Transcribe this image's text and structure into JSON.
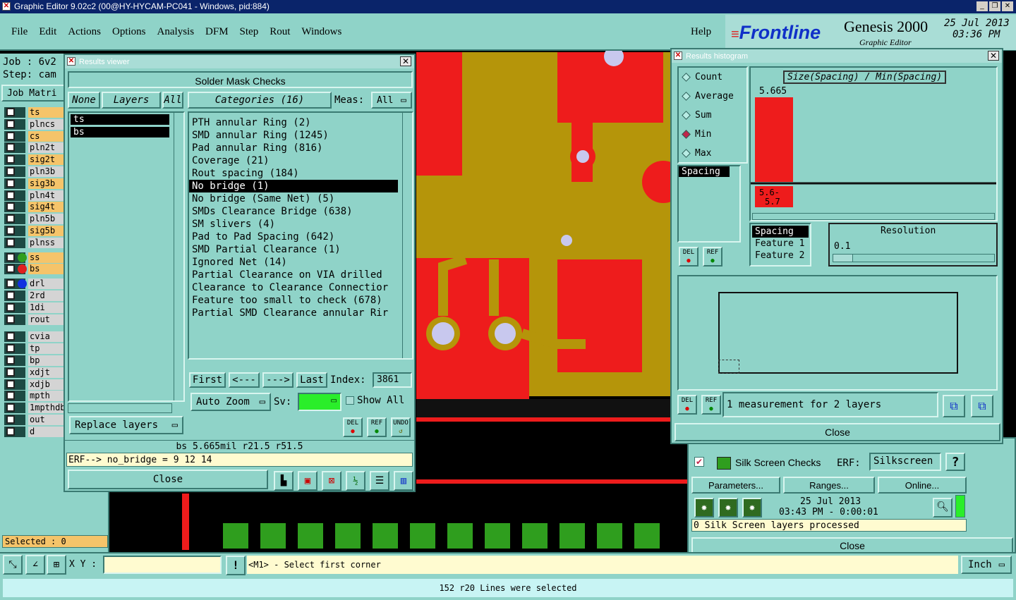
{
  "window_title": "Graphic Editor 9.02c2 (00@HY-HYCAM-PC041 - Windows, pid:884)",
  "menu": [
    "File",
    "Edit",
    "Actions",
    "Options",
    "Analysis",
    "DFM",
    "Step",
    "Rout",
    "Windows"
  ],
  "help": "Help",
  "brand": {
    "logo": "Frontline",
    "product": "Genesis 2000",
    "subtitle": "Graphic Editor",
    "date": "25 Jul 2013",
    "time": "03:36 PM"
  },
  "job_panel": {
    "job": "Job  :  6v2",
    "step": "Step: cam",
    "matrix": "Job Matri",
    "selected": "Selected : 0"
  },
  "layers": [
    {
      "name": "ts",
      "color": "#f5c46a",
      "mark": ""
    },
    {
      "name": "plncs",
      "color": "#d4d4d4",
      "mark": ""
    },
    {
      "name": "cs",
      "color": "#f5c46a",
      "mark": ""
    },
    {
      "name": "pln2t",
      "color": "#d4d4d4",
      "mark": ""
    },
    {
      "name": "sig2t",
      "color": "#f5c46a",
      "mark": ""
    },
    {
      "name": "pln3b",
      "color": "#d4d4d4",
      "mark": ""
    },
    {
      "name": "sig3b",
      "color": "#f5c46a",
      "mark": ""
    },
    {
      "name": "pln4t",
      "color": "#d4d4d4",
      "mark": ""
    },
    {
      "name": "sig4t",
      "color": "#f5c46a",
      "mark": ""
    },
    {
      "name": "pln5b",
      "color": "#d4d4d4",
      "mark": ""
    },
    {
      "name": "sig5b",
      "color": "#f5c46a",
      "mark": ""
    },
    {
      "name": "plnss",
      "color": "#d4d4d4",
      "mark": ""
    },
    {
      "name": "ss",
      "color": "#f5c46a",
      "mark": "#2f9e1e"
    },
    {
      "name": "bs",
      "color": "#f5c46a",
      "mark": "#e02020"
    },
    {
      "name": "drl",
      "color": "#d4d4d4",
      "mark": "#1030e0"
    },
    {
      "name": "2rd",
      "color": "#d4d4d4",
      "mark": ""
    },
    {
      "name": "1di",
      "color": "#d4d4d4",
      "mark": ""
    },
    {
      "name": "rout",
      "color": "#d4d4d4",
      "mark": ""
    },
    {
      "name": "cvia",
      "color": "#d4d4d4",
      "mark": ""
    },
    {
      "name": "tp",
      "color": "#d4d4d4",
      "mark": ""
    },
    {
      "name": "bp",
      "color": "#d4d4d4",
      "mark": ""
    },
    {
      "name": "xdjt",
      "color": "#d4d4d4",
      "mark": ""
    },
    {
      "name": "xdjb",
      "color": "#d4d4d4",
      "mark": ""
    },
    {
      "name": "mpth",
      "color": "#d4d4d4",
      "mark": ""
    },
    {
      "name": "1mpthdb",
      "color": "#d4d4d4",
      "mark": ""
    },
    {
      "name": "out",
      "color": "#d4d4d4",
      "mark": ""
    },
    {
      "name": "d",
      "color": "#d4d4d4",
      "mark": ""
    }
  ],
  "results_viewer": {
    "title": "Results viewer",
    "header": "Solder Mask Checks",
    "btn_none": "None",
    "btn_layers": "Layers",
    "btn_all": "All",
    "categories_label": "Categories (16)",
    "meas_label": "Meas:",
    "meas_value": "All",
    "layer_list": [
      "ts",
      "bs"
    ],
    "categories": [
      "PTH annular Ring (2)",
      "SMD annular Ring (1245)",
      "Pad annular Ring (816)",
      "Coverage (21)",
      "Rout spacing (184)",
      "No bridge (1)",
      "No bridge (Same Net) (5)",
      "SMDs Clearance Bridge (638)",
      "SM slivers (4)",
      "Pad to Pad Spacing (642)",
      "SMD Partial Clearance (1)",
      "Ignored Net (14)",
      "Partial Clearance on VIA drilled",
      "Clearance to Clearance Connectior",
      "Feature too small to check (678)",
      "Partial SMD Clearance annular Rir"
    ],
    "selected_category": 5,
    "nav": {
      "first": "First",
      "prev": "<---",
      "next": "--->",
      "last": "Last",
      "index_label": "Index:",
      "index_value": "3861"
    },
    "auto_zoom": "Auto Zoom",
    "sv_label": "Sv:",
    "show_all": "Show All",
    "replace_layers": "Replace layers",
    "del": "DEL",
    "ref": "REF",
    "undo": "UNDO",
    "measure": "bs 5.665mil   r21.5   r51.5",
    "erf": "ERF--> no_bridge = 9 12 14",
    "close": "Close"
  },
  "histogram": {
    "title": "Results histogram",
    "modes": [
      "Count",
      "Average",
      "Sum",
      "Min",
      "Max"
    ],
    "selected_mode": 3,
    "list": [
      "Spacing"
    ],
    "chart_title": "Size(Spacing) / Min(Spacing)",
    "bar_value": "5.665",
    "bar_bucket": "5.6-\n5.7",
    "fields": [
      "Spacing",
      "Feature 1",
      "Feature 2"
    ],
    "resolution_label": "Resolution",
    "resolution_value": "0.1",
    "status": "1 measurement for 2 layers",
    "del": "DEL",
    "ref": "REF",
    "close": "Close",
    "chart_data": {
      "type": "bar",
      "categories": [
        "5.6-5.7"
      ],
      "values": [
        5.665
      ],
      "title": "Size(Spacing) / Min(Spacing)"
    }
  },
  "silk": {
    "label": "Silk Screen Checks",
    "erf_label": "ERF:",
    "erf_value": "Silkscreen",
    "help": "?",
    "parameters": "Parameters...",
    "ranges": "Ranges...",
    "online": "Online...",
    "date": "25 Jul 2013",
    "time": "03:43 PM - 0:00:01",
    "status": "0 Silk Screen layers processed",
    "close": "Close"
  },
  "bottom": {
    "xy_label": "X Y :",
    "xy_value": "",
    "prompt": "<M1> - Select first corner",
    "units": "Inch",
    "status": "152 r20 Lines were selected"
  }
}
